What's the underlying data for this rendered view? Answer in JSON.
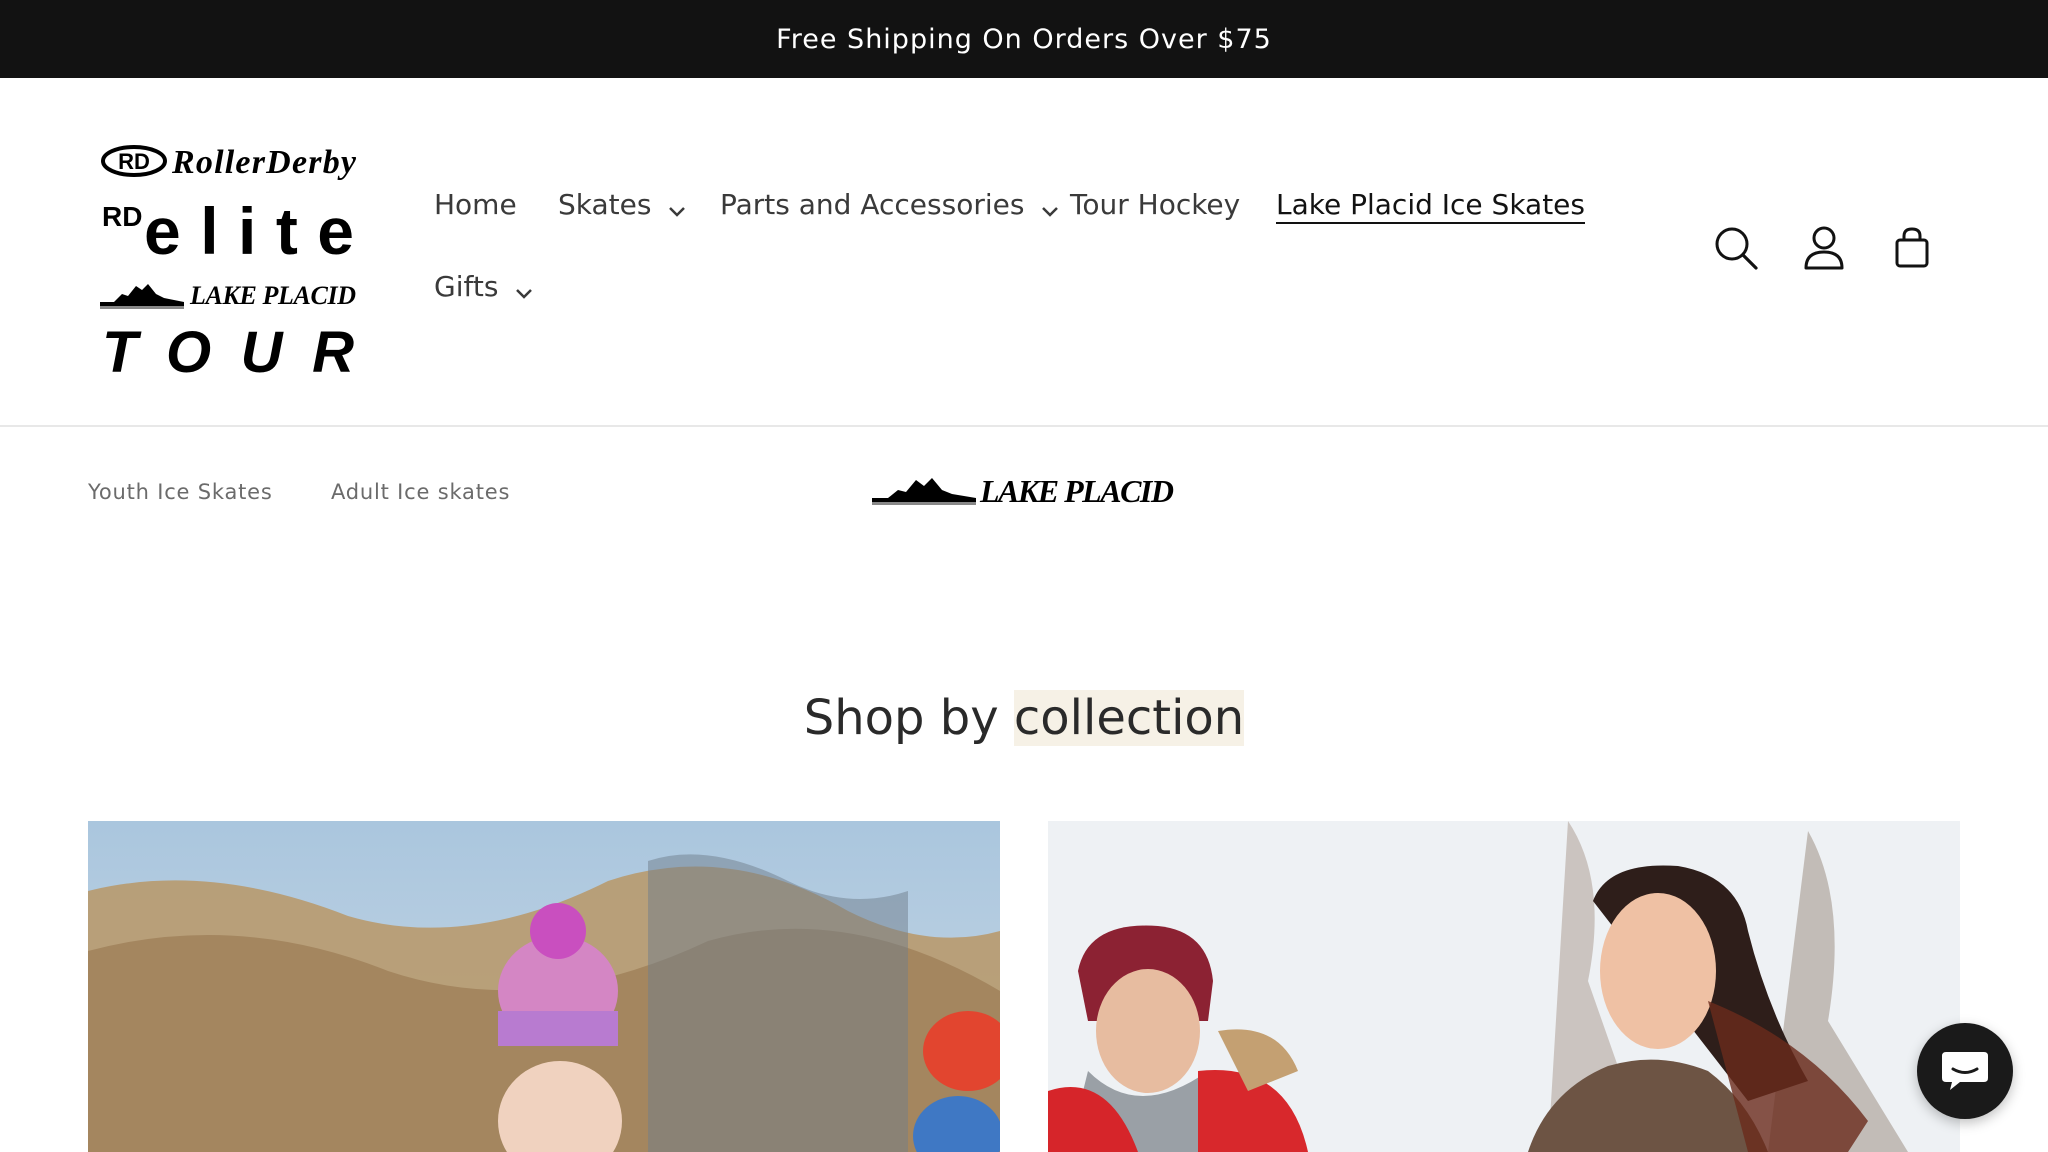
{
  "announcement": {
    "text": "Free Shipping On Orders Over $75"
  },
  "brand_logo": {
    "lines": [
      "RollerDerby",
      "elite",
      "LAKE PLACID",
      "TOUR"
    ],
    "rd_mark": "RD"
  },
  "nav": {
    "items": [
      {
        "label": "Home",
        "has_dropdown": false,
        "active": false
      },
      {
        "label": "Skates",
        "has_dropdown": true,
        "active": false
      },
      {
        "label": "Parts and Accessories",
        "has_dropdown": true,
        "active": false
      },
      {
        "label": "Tour Hockey",
        "has_dropdown": false,
        "active": false
      },
      {
        "label": "Lake Placid Ice Skates",
        "has_dropdown": false,
        "active": true
      },
      {
        "label": "Gifts",
        "has_dropdown": true,
        "active": false
      }
    ]
  },
  "header_icons": [
    "search-icon",
    "account-icon",
    "cart-icon"
  ],
  "subnav": {
    "items": [
      "Youth Ice Skates",
      "Adult Ice skates"
    ]
  },
  "collection_logo": {
    "text": "LAKE PLACID"
  },
  "section": {
    "title_prefix": "Shop by ",
    "title_highlight": "collection"
  },
  "collections": [
    {
      "image": "child-with-pink-knit-hat-ice-skating-photo"
    },
    {
      "image": "couple-smiling-winter-skating-photo"
    }
  ],
  "chat": {
    "icon": "chat-icon"
  },
  "colors": {
    "announcement_bg": "#121212",
    "text": "#121212",
    "chat_bg": "#1a1a1a",
    "highlight": "#f6f1e6"
  }
}
